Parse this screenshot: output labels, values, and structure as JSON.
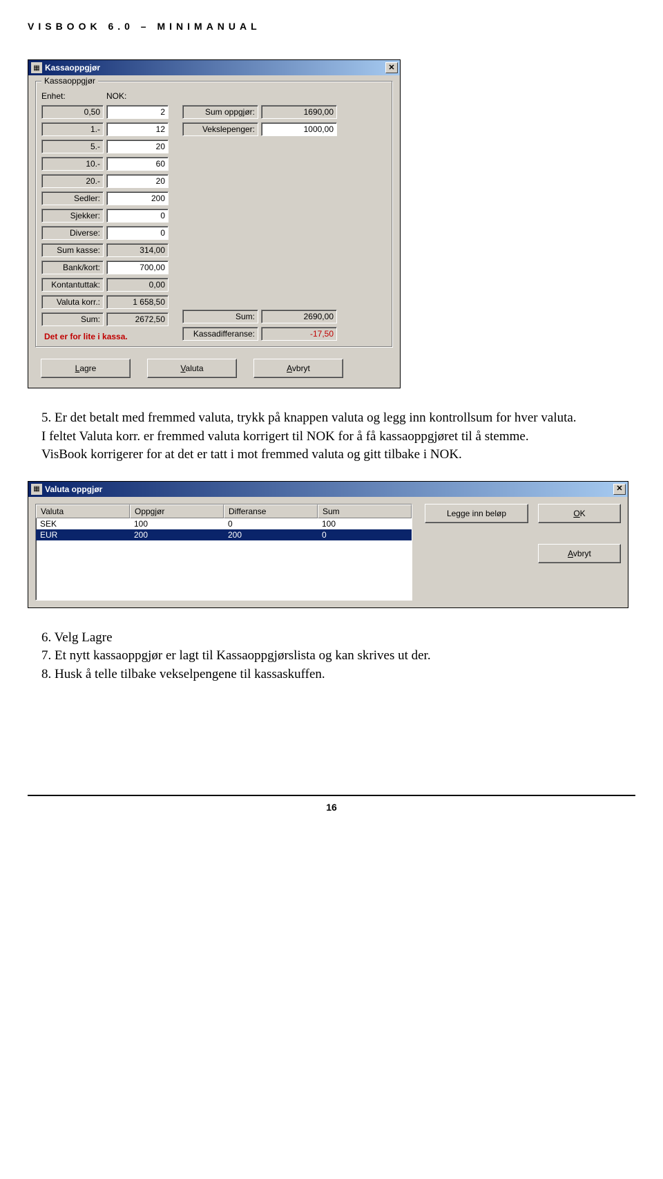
{
  "header": "VISBOOK 6.0 – MINIMANUAL",
  "kassa": {
    "title": "Kassaoppgjør",
    "group": "Kassaoppgjør",
    "enhet_label": "Enhet:",
    "nok_label": "NOK:",
    "rows_left": [
      {
        "enhet": "0,50",
        "nok": "2"
      },
      {
        "enhet": "1.-",
        "nok": "12"
      },
      {
        "enhet": "5.-",
        "nok": "20"
      },
      {
        "enhet": "10.-",
        "nok": "60"
      },
      {
        "enhet": "20.-",
        "nok": "20"
      },
      {
        "enhet": "Sedler:",
        "nok": "200"
      },
      {
        "enhet": "Sjekker:",
        "nok": "0"
      },
      {
        "enhet": "Diverse:",
        "nok": "0"
      },
      {
        "enhet": "Sum kasse:",
        "nok": "314,00"
      },
      {
        "enhet": "Bank/kort:",
        "nok": "700,00"
      },
      {
        "enhet": "Kontantuttak:",
        "nok": "0,00"
      },
      {
        "enhet": "Valuta korr.:",
        "nok": "1 658,50"
      },
      {
        "enhet": "Sum:",
        "nok": "2672,50"
      }
    ],
    "rows_right": [
      {
        "label": "Sum oppgjør:",
        "val": "1690,00"
      },
      {
        "label": "Vekslepenger:",
        "val": "1000,00"
      }
    ],
    "right_sum": {
      "label": "Sum:",
      "val": "2690,00"
    },
    "right_diff": {
      "label": "Kassadifferanse:",
      "val": "-17,50"
    },
    "error": "Det er for lite i kassa.",
    "btn_lagre": "Lagre",
    "btn_valuta": "Valuta",
    "btn_avbryt": "Avbryt"
  },
  "paragraph1": "5. Er det betalt med fremmed valuta, trykk på knappen valuta og legg inn kontrollsum for hver valuta.",
  "paragraph2": "I feltet Valuta korr. er fremmed valuta korrigert til NOK for å få kassaoppgjøret til å stemme.",
  "paragraph3": "VisBook korrigerer for at det er tatt i mot fremmed valuta og gitt tilbake i NOK.",
  "valuta": {
    "title": "Valuta oppgjør",
    "cols": [
      "Valuta",
      "Oppgjør",
      "Differanse",
      "Sum"
    ],
    "rows": [
      {
        "c": [
          "SEK",
          "100",
          "0",
          "100"
        ],
        "sel": false
      },
      {
        "c": [
          "EUR",
          "200",
          "200",
          "0"
        ],
        "sel": true
      }
    ],
    "btn_legg": "Legge inn beløp",
    "btn_ok": "OK",
    "btn_avbryt": "Avbryt"
  },
  "paragraph4": "6. Velg Lagre",
  "paragraph5": "7. Et nytt kassaoppgjør er lagt til Kassaoppgjørslista og kan skrives ut der.",
  "paragraph6": "8. Husk å telle tilbake vekselpengene til kassaskuffen.",
  "page_number": "16"
}
